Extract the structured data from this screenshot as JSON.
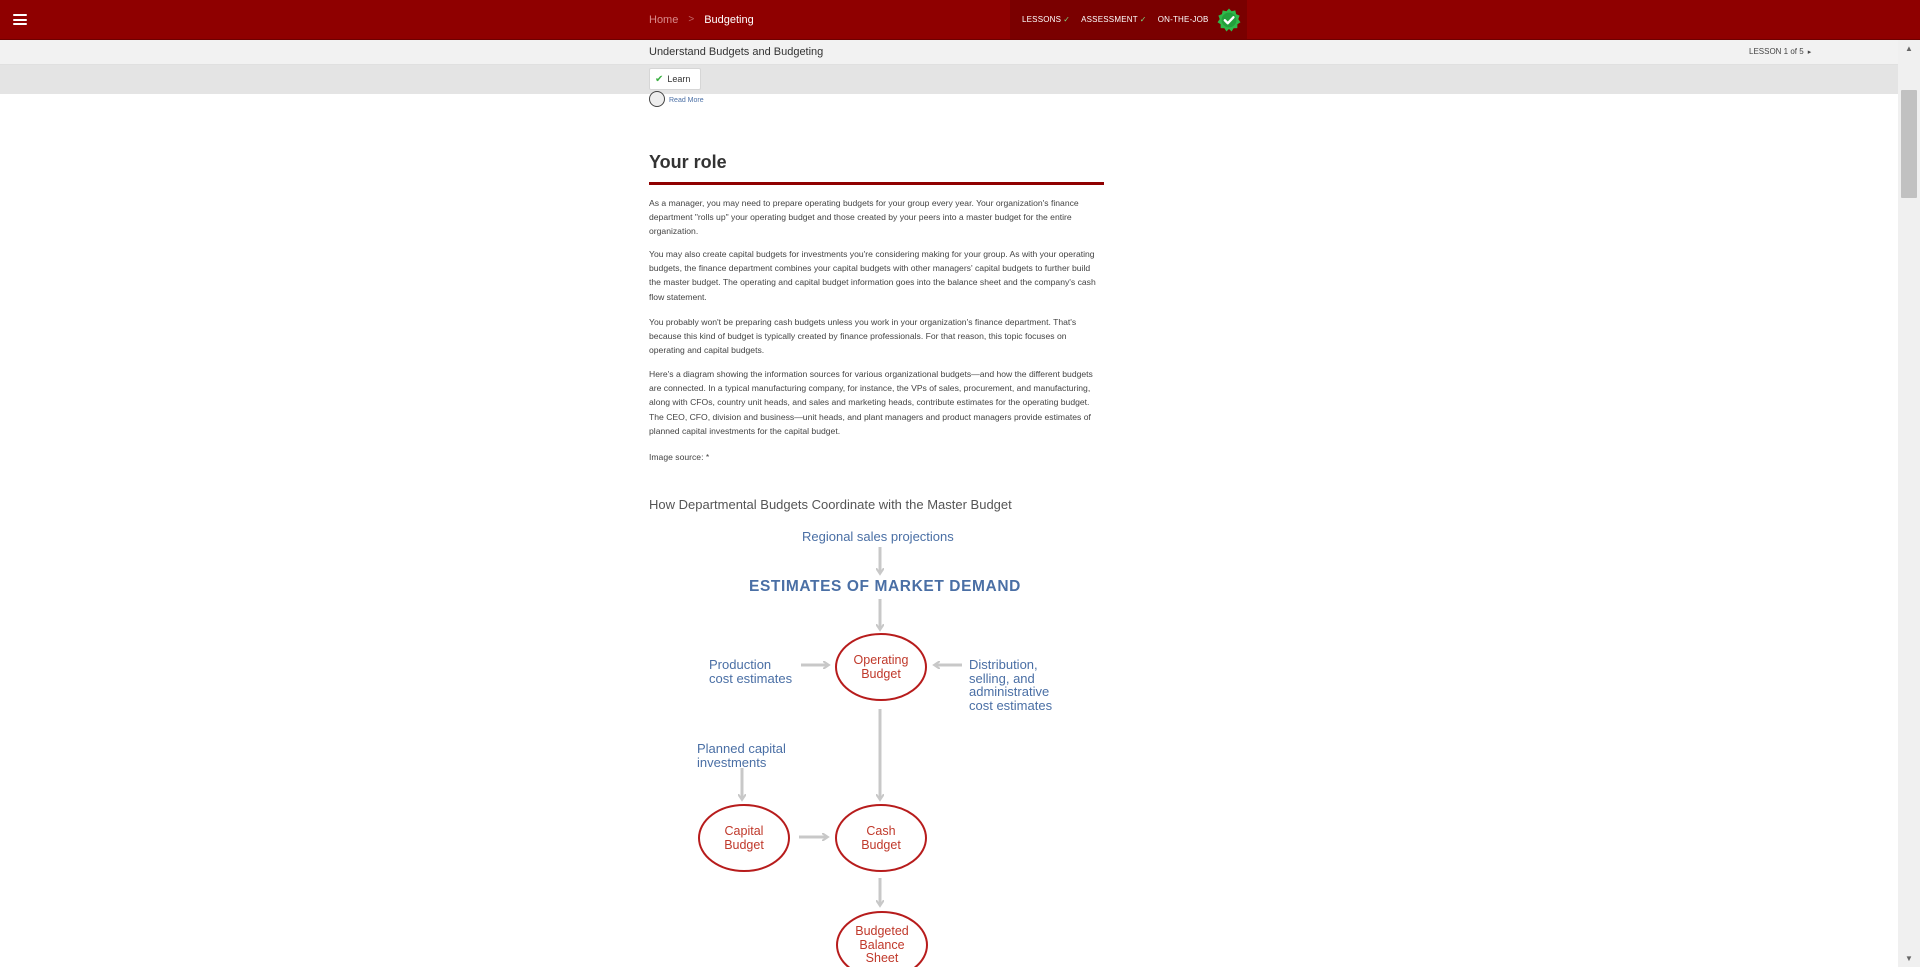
{
  "topbar": {
    "breadcrumb_home": "Home",
    "breadcrumb_separator": ">",
    "breadcrumb_current": "Budgeting",
    "progress_items": [
      {
        "label": "LESSONS",
        "done": true
      },
      {
        "label": "ASSESSMENT",
        "done": true
      },
      {
        "label": "ON-THE-JOB",
        "done": false
      }
    ],
    "checkmark": "✓",
    "brand_color": "#8f0000",
    "badge_color": "#2fb94a",
    "menu_icon": "hamburger-icon",
    "badge_icon": "completed-badge-icon"
  },
  "subheader": {
    "lesson_title": "Understand Budgets and Budgeting",
    "lesson_count": "LESSON 1 of 5",
    "lesson_arrow": "▸"
  },
  "tabs": {
    "learn_label": "Learn",
    "learn_check": "✔"
  },
  "content": {
    "read_more": "Read More",
    "section_heading": "Your role",
    "paragraphs": [
      "As a manager, you may need to prepare operating budgets for your group every year. Your organization's finance department \"rolls up\" your operating budget and those created by your peers into a master budget for the entire organization.",
      "You may also create capital budgets for investments you're considering making for your group. As with your operating budgets, the finance department combines your capital budgets with other managers' capital budgets to further build the master budget. The operating and capital budget information goes into the balance sheet and the company's cash flow statement.",
      "You probably won't be preparing cash budgets unless you work in your organization's finance department. That's because this kind of budget is typically created by finance professionals. For that reason, this topic focuses on operating and capital budgets.",
      "Here's a diagram showing the information sources for various organizational budgets—and how the different budgets are connected. In a typical manufacturing company, for instance, the VPs of sales, procurement, and manufacturing, along with CFOs, country unit heads, and sales and marketing heads, contribute estimates for the operating budget. The CEO, CFO, division and business—unit heads, and plant managers and product managers provide estimates of planned capital investments for the capital budget."
    ],
    "image_source": "Image source: *",
    "diagram_title": "How Departmental Budgets Coordinate with the Master Budget"
  },
  "diagram": {
    "regional_sales": "Regional sales projections",
    "market_demand": "ESTIMATES OF MARKET DEMAND",
    "production_cost_line1": "Production",
    "production_cost_line2": "cost estimates",
    "distribution_line1": "Distribution,",
    "distribution_line2": "selling, and",
    "distribution_line3": "administrative",
    "distribution_line4": "cost estimates",
    "planned_capital_line1": "Planned capital",
    "planned_capital_line2": "investments",
    "operating_line1": "Operating",
    "operating_line2": "Budget",
    "capital_line1": "Capital",
    "capital_line2": "Budget",
    "cash_line1": "Cash",
    "cash_line2": "Budget",
    "balance_line1": "Budgeted",
    "balance_line2": "Balance",
    "balance_line3": "Sheet",
    "ellipse_color": "#b71c1c",
    "arrow_color": "#c8c8c8",
    "label_color": "#4a6fa5"
  },
  "scrollbar": {
    "up_arrow": "▲",
    "down_arrow": "▼"
  }
}
